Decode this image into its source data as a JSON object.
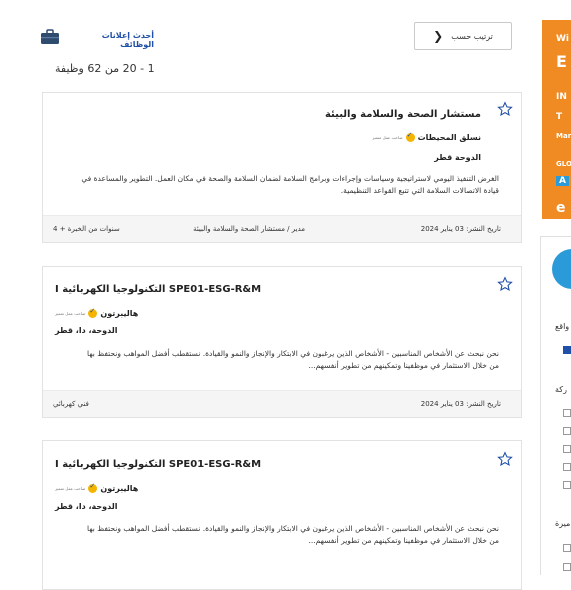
{
  "header": {
    "sort_label": "ترتيب حسب",
    "latest_label": "أحدث إعلانات الوظائف",
    "count_text": "1 - 20 من 62 وظيفة"
  },
  "side": {
    "banner_lines": [
      "Wi",
      "E",
      "IN",
      "T",
      "Mar",
      "GLO",
      "A",
      "e"
    ],
    "filter_label_1": "واقع",
    "filter_label_2": "ركة",
    "filter_label_3": "ميرة"
  },
  "jobs": [
    {
      "title": "مستشار الصحة والسلامة والبيئة",
      "company": "نسلق المحيطات",
      "company_tag": "صاحب عمل متميز",
      "location": "الدوحة قطر",
      "description_1": "الغرض التنفيذ اليومي لاستراتيجية وسياسات وإجراءات وبرامج السلامة لضمان السلامة والصحة في مكان العمل. التطوير والمساعدة في",
      "description_2": "قيادة الاتصالات السلامة التي تتبع القواعد التنظيمية.",
      "posted": "تاريخ النشر: 03 يناير 2024",
      "role": "مدير / مستشار الصحة والسلامة والبيئة",
      "experience": "سنوات من الخبرة + 4"
    },
    {
      "title": "I التكنولوجيا الكهربائية SPE01-ESG-R&M",
      "company": "هاليبرتون",
      "company_tag": "صاحب عمل متميز",
      "location": "الدوحة، دا، قطر",
      "description_1": "نحن نبحث عن الأشخاص المناسبين - الأشخاص الذين يرغبون في الابتكار والإنجاز والنمو والقيادة. نستقطب أفضل المواهب ونحتفظ بها",
      "description_2": "من خلال الاستثمار في موظفينا وتمكينهم من تطوير أنفسهم...",
      "posted": "تاريخ النشر: 03 يناير 2024",
      "role": "فني كهربائي",
      "experience": ""
    },
    {
      "title": "I التكنولوجيا الكهربائية SPE01-ESG-R&M",
      "company": "هاليبرتون",
      "company_tag": "صاحب عمل متميز",
      "location": "الدوحة، دا، قطر",
      "description_1": "نحن نبحث عن الأشخاص المناسبين - الأشخاص الذين يرغبون في الابتكار والإنجاز والنمو والقيادة. نستقطب أفضل المواهب ونحتفظ بها",
      "description_2": "من خلال الاستثمار في موظفينا وتمكينهم من تطوير أنفسهم...",
      "posted": "",
      "role": "",
      "experience": ""
    }
  ],
  "colors": {
    "accent": "#1f4fa6",
    "banner": "#f08a22",
    "circle": "#2a9bd8",
    "badge": "#f4b400"
  }
}
